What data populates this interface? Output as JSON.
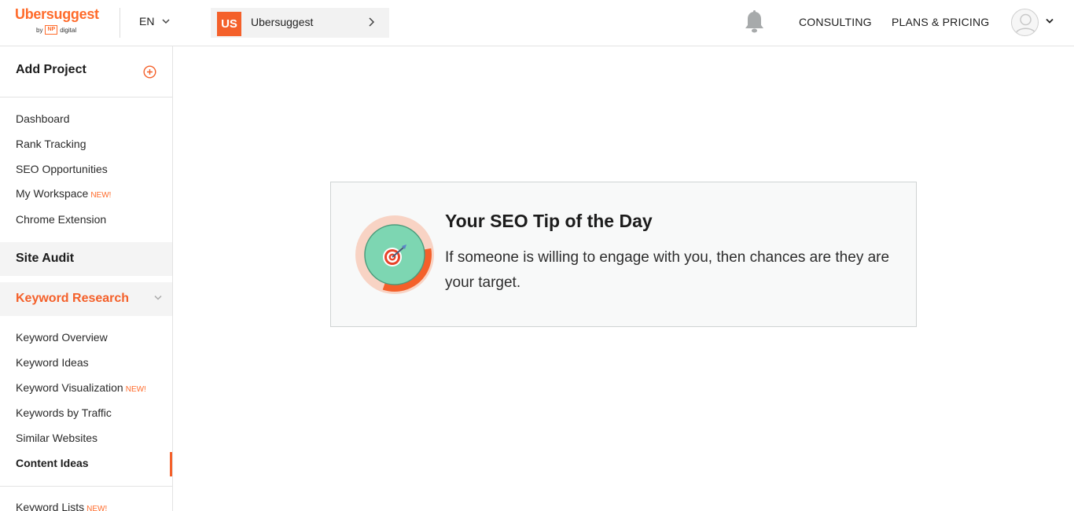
{
  "header": {
    "brand": "Ubersuggest",
    "brand_by": "by",
    "brand_np": "NP",
    "brand_digital": "digital",
    "language": "EN",
    "project": {
      "badge": "US",
      "name": "Ubersuggest"
    },
    "nav": {
      "consulting": "CONSULTING",
      "plans_pricing": "PLANS & PRICING"
    }
  },
  "sidebar": {
    "add_project": "Add Project",
    "dashboard_items": [
      {
        "label": "Dashboard",
        "new": ""
      },
      {
        "label": "Rank Tracking",
        "new": ""
      },
      {
        "label": "SEO Opportunities",
        "new": ""
      },
      {
        "label": "My Workspace",
        "new": "NEW!"
      },
      {
        "label": "Chrome Extension",
        "new": ""
      }
    ],
    "site_audit": "Site Audit",
    "keyword_research": "Keyword Research",
    "keyword_items": [
      {
        "label": "Keyword Overview",
        "new": ""
      },
      {
        "label": "Keyword Ideas",
        "new": ""
      },
      {
        "label": "Keyword Visualization",
        "new": "NEW!"
      },
      {
        "label": "Keywords by Traffic",
        "new": ""
      },
      {
        "label": "Similar Websites",
        "new": ""
      },
      {
        "label": "Content Ideas",
        "new": ""
      }
    ],
    "keyword_lists": {
      "label": "Keyword Lists",
      "new": "NEW!"
    }
  },
  "tip": {
    "title": "Your SEO Tip of the Day",
    "body": "If someone is willing to engage with you, then chances are they are your target.",
    "progress": 0.33
  },
  "colors": {
    "accent": "#f4602a",
    "brand_orange": "#ff6b2b",
    "target_green": "#7dd6b2",
    "ring_light": "#f8d3c4"
  },
  "icons": {
    "plus": "plus-circle-icon",
    "bell": "bell-icon",
    "avatar": "user-avatar-icon",
    "target": "target-dart-icon"
  }
}
